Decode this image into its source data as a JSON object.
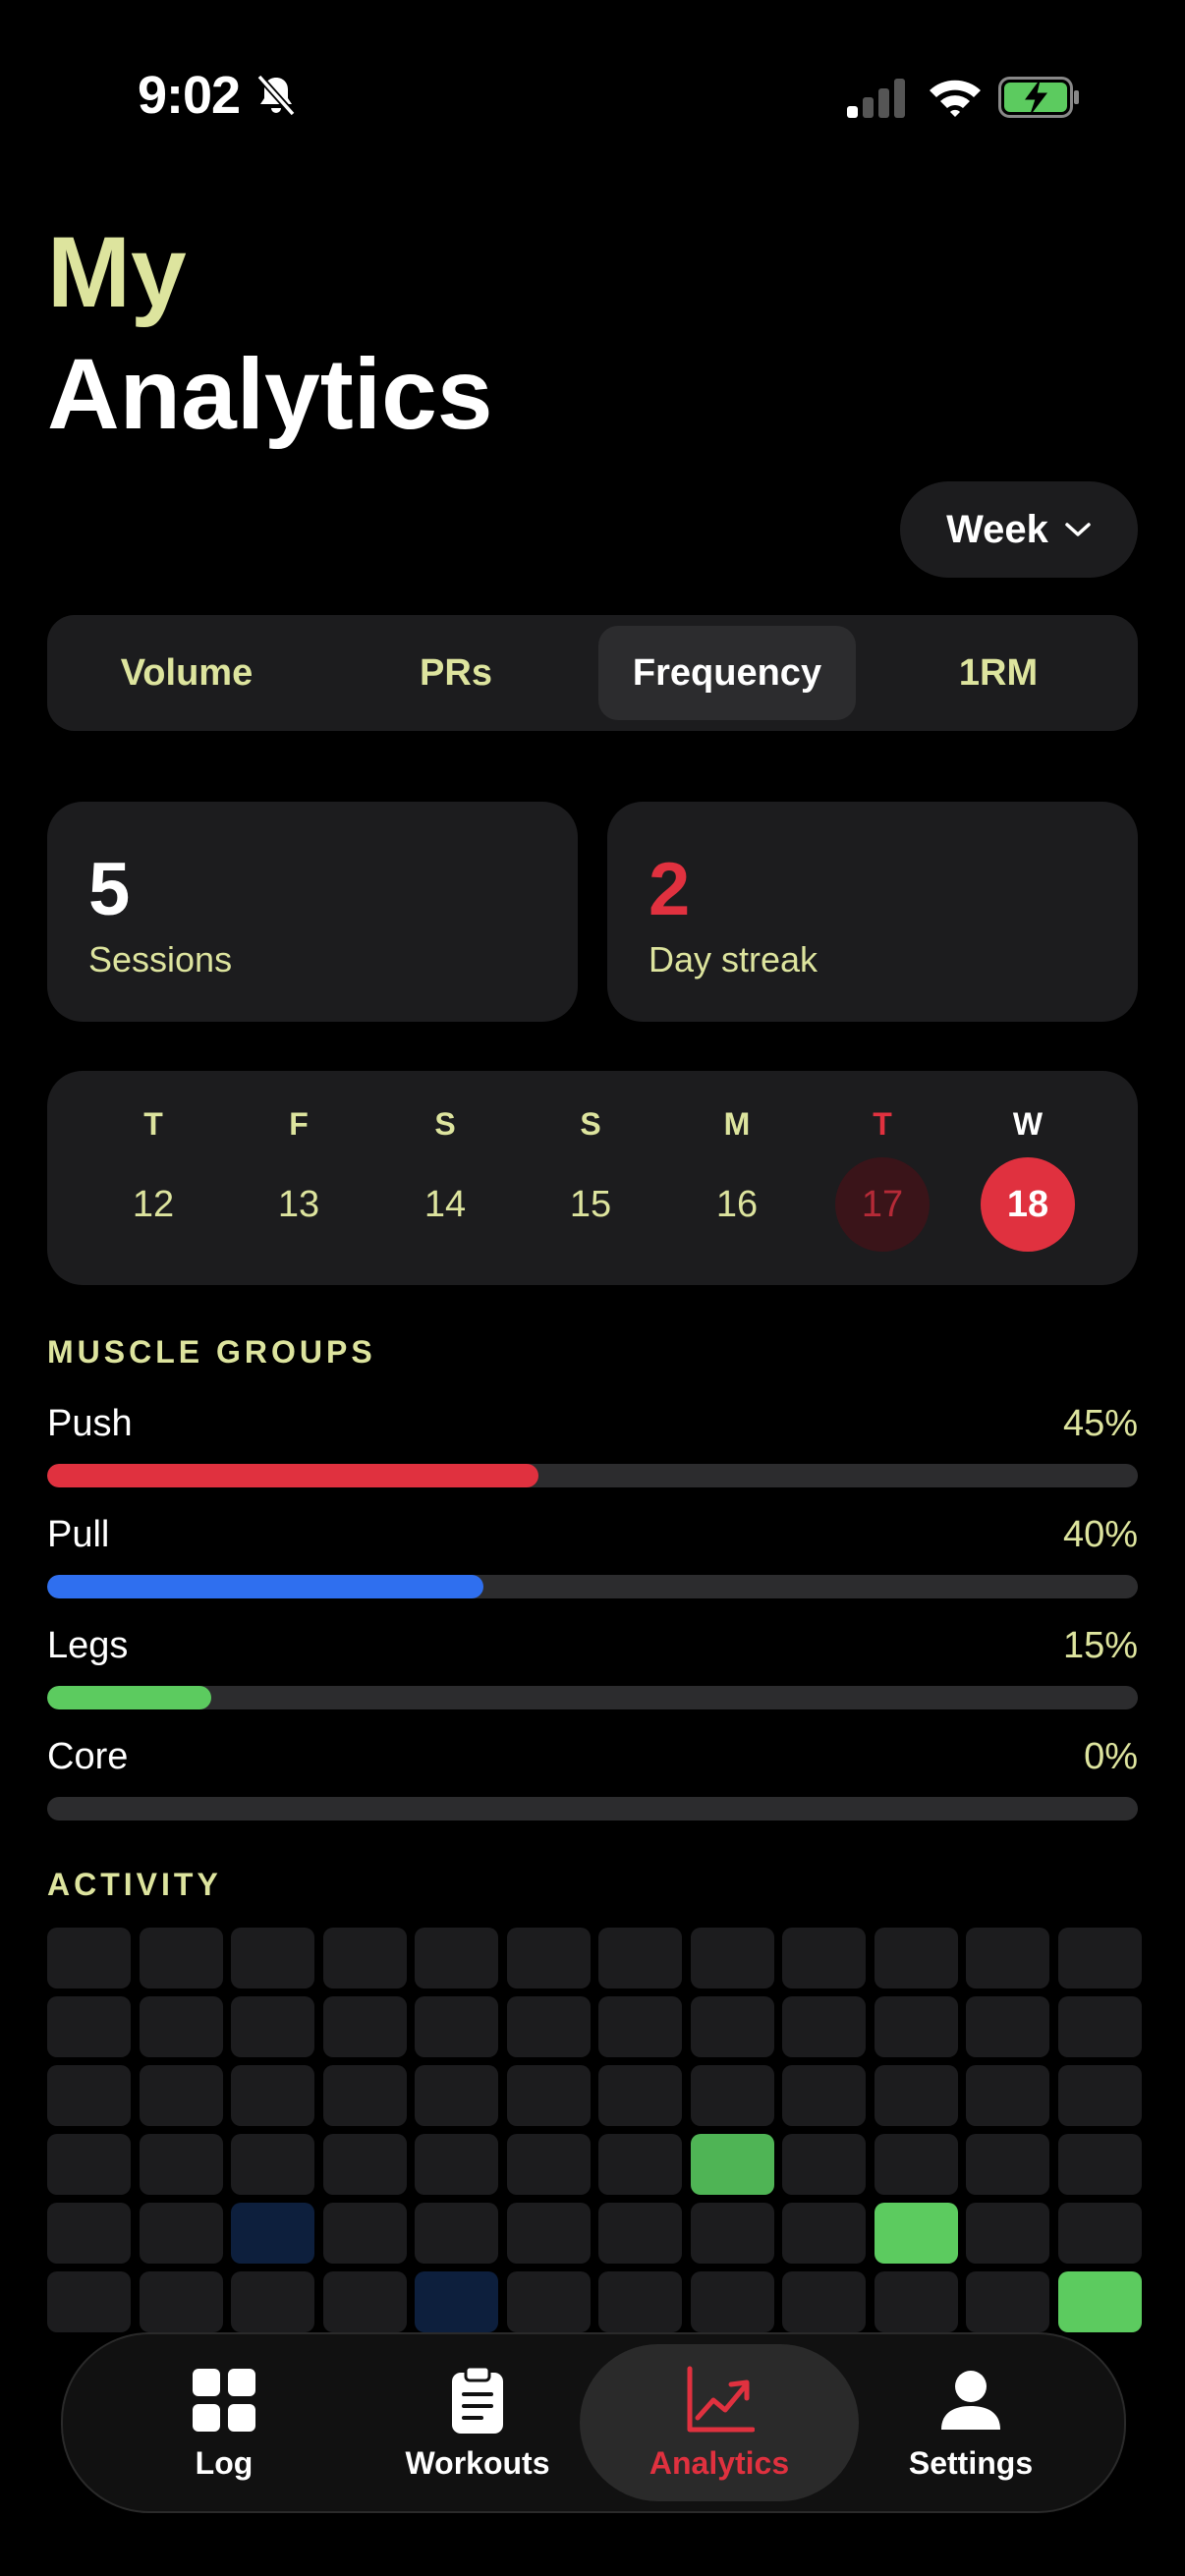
{
  "status_bar": {
    "time": "9:02"
  },
  "header": {
    "title_line1": "My",
    "title_line2": "Analytics"
  },
  "period": {
    "selected": "Week"
  },
  "tabs": [
    {
      "label": "Volume",
      "active": false
    },
    {
      "label": "PRs",
      "active": false
    },
    {
      "label": "Frequency",
      "active": true
    },
    {
      "label": "1RM",
      "active": false
    }
  ],
  "stats": {
    "sessions": {
      "value": "5",
      "label": "Sessions"
    },
    "streak": {
      "value": "2",
      "label": "Day streak"
    }
  },
  "calendar": {
    "days": [
      {
        "letter": "T",
        "date": "12"
      },
      {
        "letter": "F",
        "date": "13"
      },
      {
        "letter": "S",
        "date": "14"
      },
      {
        "letter": "S",
        "date": "15"
      },
      {
        "letter": "M",
        "date": "16"
      },
      {
        "letter": "T",
        "date": "17"
      },
      {
        "letter": "W",
        "date": "18"
      }
    ]
  },
  "muscle_groups": {
    "heading": "MUSCLE GROUPS",
    "items": [
      {
        "name": "Push",
        "percent_label": "45%",
        "percent": 45,
        "color": "#e0313f"
      },
      {
        "name": "Pull",
        "percent_label": "40%",
        "percent": 40,
        "color": "#2f6fef"
      },
      {
        "name": "Legs",
        "percent_label": "15%",
        "percent": 15,
        "color": "#5ccb5f"
      },
      {
        "name": "Core",
        "percent_label": "0%",
        "percent": 0,
        "color": "#5ccb5f"
      }
    ]
  },
  "activity": {
    "heading": "ACTIVITY",
    "rows": 6,
    "cols": 12,
    "highlights": [
      {
        "row": 3,
        "col": 7,
        "color": "#4fb455"
      },
      {
        "row": 4,
        "col": 2,
        "color": "#0d1f3d"
      },
      {
        "row": 4,
        "col": 9,
        "color": "#5ccb5f"
      },
      {
        "row": 5,
        "col": 4,
        "color": "#0d1f3d"
      },
      {
        "row": 5,
        "col": 11,
        "color": "#5ccb5f"
      }
    ]
  },
  "nav": {
    "items": [
      {
        "label": "Log",
        "icon": "grid-icon"
      },
      {
        "label": "Workouts",
        "icon": "clipboard-icon"
      },
      {
        "label": "Analytics",
        "icon": "chart-icon",
        "active": true
      },
      {
        "label": "Settings",
        "icon": "person-icon"
      }
    ]
  },
  "colors": {
    "accent": "#e0313f",
    "label_yellow": "#dde49e",
    "card": "#1c1c1e"
  }
}
